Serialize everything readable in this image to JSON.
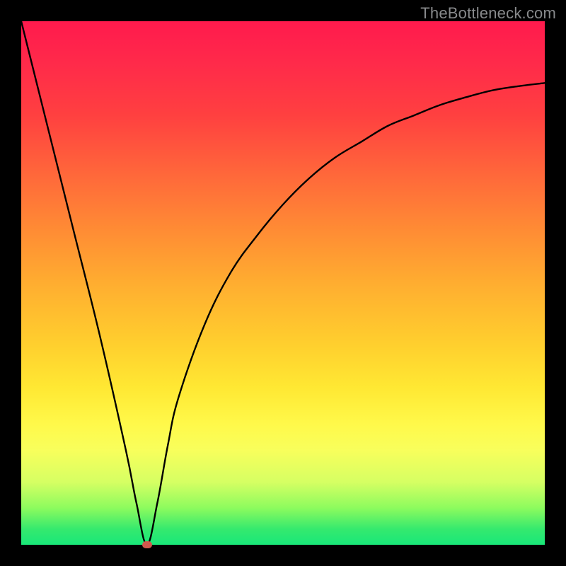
{
  "watermark": "TheBottleneck.com",
  "colors": {
    "frame": "#000000",
    "curve": "#000000",
    "marker": "#d1584d",
    "gradient_top": "#ff1a4d",
    "gradient_mid": "#ffe833",
    "gradient_bottom": "#19e879"
  },
  "chart_data": {
    "type": "line",
    "title": "",
    "xlabel": "",
    "ylabel": "",
    "xlim": [
      0,
      100
    ],
    "ylim": [
      0,
      100
    ],
    "note": "Y value is a bottleneck percentage; 0 at the minimum (green), 100 at top (red). Curve drops steeply to a minimum near x≈24 then rises toward ~88 at the right edge.",
    "series": [
      {
        "name": "bottleneck-curve",
        "x": [
          0,
          5,
          10,
          15,
          20,
          22,
          24,
          26,
          28,
          30,
          35,
          40,
          45,
          50,
          55,
          60,
          65,
          70,
          75,
          80,
          85,
          90,
          95,
          100
        ],
        "y": [
          100,
          80,
          60,
          40,
          18,
          8,
          0,
          8,
          19,
          28,
          42,
          52,
          59,
          65,
          70,
          74,
          77,
          80,
          82,
          84,
          85.5,
          86.8,
          87.6,
          88.2
        ]
      }
    ],
    "marker": {
      "x": 24,
      "y": 0,
      "name": "minimum-point"
    },
    "grid": false,
    "legend": false
  }
}
